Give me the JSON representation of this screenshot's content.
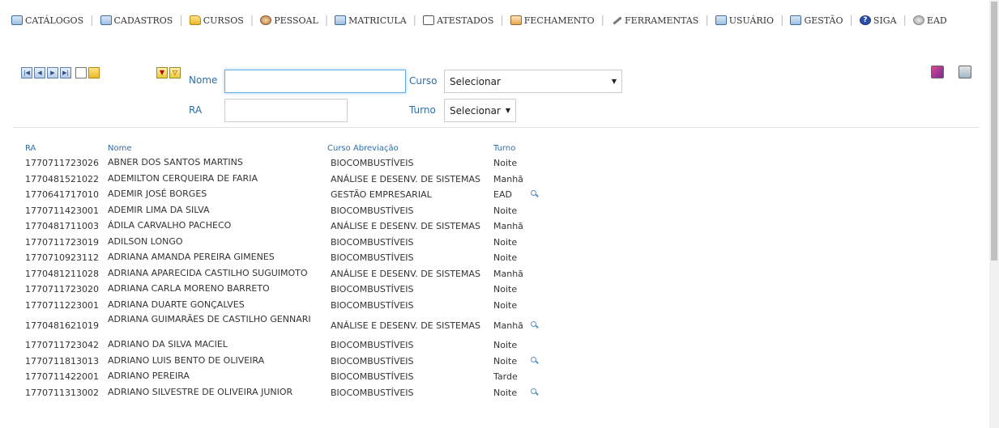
{
  "menu": {
    "items": [
      {
        "label": "CATÁLOGOS",
        "icon": "book-icon"
      },
      {
        "label": "CADASTROS",
        "icon": "form-icon"
      },
      {
        "label": "CURSOS",
        "icon": "folder-icon"
      },
      {
        "label": "PESSOAL",
        "icon": "people-icon"
      },
      {
        "label": "MATRICULA",
        "icon": "form-icon"
      },
      {
        "label": "ATESTADOS",
        "icon": "printer-icon"
      },
      {
        "label": "FECHAMENTO",
        "icon": "calculator-icon"
      },
      {
        "label": "FERRAMENTAS",
        "icon": "tools-icon"
      },
      {
        "label": "USUÁRIO",
        "icon": "monitor-icon"
      },
      {
        "label": "GESTÃO",
        "icon": "monitor-icon"
      },
      {
        "label": "SIGA",
        "icon": "help-icon"
      },
      {
        "label": "EAD",
        "icon": "globe-icon"
      }
    ]
  },
  "toolbar": {
    "nav_buttons": [
      {
        "name": "first-record-button",
        "glyph": "|◀"
      },
      {
        "name": "previous-record-button",
        "glyph": "◀"
      },
      {
        "name": "next-record-button",
        "glyph": "▶"
      },
      {
        "name": "last-record-button",
        "glyph": "▶|"
      }
    ],
    "filter_buttons": [
      {
        "name": "apply-filter-button",
        "glyph": "▼"
      },
      {
        "name": "clear-filter-button",
        "glyph": "▽"
      }
    ]
  },
  "form": {
    "nome_label": "Nome",
    "nome_value": "",
    "ra_label": "RA",
    "ra_value": "",
    "curso_label": "Curso",
    "curso_selected": "Selecionar",
    "turno_label": "Turno",
    "turno_selected": "Selecionar"
  },
  "table": {
    "headers": {
      "ra": "RA",
      "nome": "Nome",
      "curso": "Curso Abreviação",
      "turno": "Turno"
    },
    "rows": [
      {
        "ra": "1770711723026",
        "nome": "ABNER DOS SANTOS MARTINS",
        "curso": "BIOCOMBUSTÍVEIS",
        "turno": "Noite",
        "search": false
      },
      {
        "ra": "1770481521022",
        "nome": "ADEMILTON CERQUEIRA DE FARIA",
        "curso": "ANÁLISE E DESENV. DE SISTEMAS",
        "turno": "Manhã",
        "search": false
      },
      {
        "ra": "1770641717010",
        "nome": "ADEMIR JOSÉ BORGES",
        "curso": "GESTÃO EMPRESARIAL",
        "turno": "EAD",
        "search": true
      },
      {
        "ra": "1770711423001",
        "nome": "ADEMIR LIMA DA SILVA",
        "curso": "BIOCOMBUSTÍVEIS",
        "turno": "Noite",
        "search": false
      },
      {
        "ra": "1770481711003",
        "nome": "ÁDILA CARVALHO PACHECO",
        "curso": "ANÁLISE E DESENV. DE SISTEMAS",
        "turno": "Manhã",
        "search": false
      },
      {
        "ra": "1770711723019",
        "nome": "ADILSON LONGO",
        "curso": "BIOCOMBUSTÍVEIS",
        "turno": "Noite",
        "search": false
      },
      {
        "ra": "1770710923112",
        "nome": "ADRIANA AMANDA PEREIRA GIMENES",
        "curso": "BIOCOMBUSTÍVEIS",
        "turno": "Noite",
        "search": false
      },
      {
        "ra": "1770481211028",
        "nome": "ADRIANA APARECIDA CASTILHO SUGUIMOTO",
        "curso": "ANÁLISE E DESENV. DE SISTEMAS",
        "turno": "Manhã",
        "search": false
      },
      {
        "ra": "1770711723020",
        "nome": "ADRIANA CARLA MORENO BARRETO",
        "curso": "BIOCOMBUSTÍVEIS",
        "turno": "Noite",
        "search": false
      },
      {
        "ra": "1770711223001",
        "nome": "ADRIANA DUARTE GONÇALVES",
        "curso": "BIOCOMBUSTÍVEIS",
        "turno": "Noite",
        "search": false
      },
      {
        "ra": "1770481621019",
        "nome": "ADRIANA GUIMARÃES DE CASTILHO GENNARI",
        "curso": "ANÁLISE E DESENV. DE SISTEMAS",
        "turno": "Manhã",
        "search": true,
        "tall": true
      },
      {
        "ra": "1770711723042",
        "nome": "ADRIANO DA SILVA MACIEL",
        "curso": "BIOCOMBUSTÍVEIS",
        "turno": "Noite",
        "search": false
      },
      {
        "ra": "1770711813013",
        "nome": "ADRIANO LUIS BENTO DE OLIVEIRA",
        "curso": "BIOCOMBUSTÍVEIS",
        "turno": "Noite",
        "search": true
      },
      {
        "ra": "1770711422001",
        "nome": "ADRIANO PEREIRA",
        "curso": "BIOCOMBUSTÍVEIS",
        "turno": "Tarde",
        "search": false
      },
      {
        "ra": "1770711313002",
        "nome": "ADRIANO SILVESTRE DE OLIVEIRA JUNIOR",
        "curso": "BIOCOMBUSTÍVEIS",
        "turno": "Noite",
        "search": true
      }
    ]
  }
}
